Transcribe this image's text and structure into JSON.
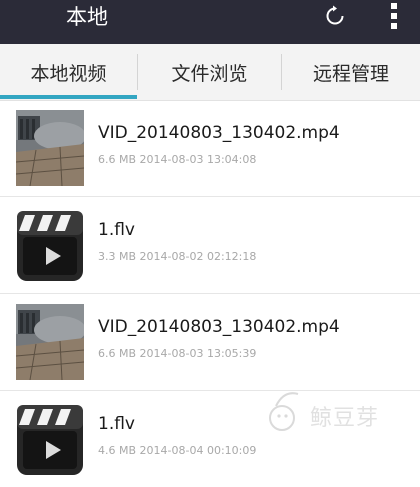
{
  "app": {
    "title": "本地",
    "icons": {
      "refresh": "refresh-icon",
      "more": "more-vert-icon"
    }
  },
  "tabs": [
    {
      "label": "本地视频",
      "active": true
    },
    {
      "label": "文件浏览",
      "active": false
    },
    {
      "label": "远程管理",
      "active": false
    }
  ],
  "colors": {
    "topbar": "#2b2b38",
    "tab_indicator": "#33a6c2",
    "meta_text": "#a8a8a8"
  },
  "files": [
    {
      "name": "VID_20140803_130402.mp4",
      "size": "6.6 MB",
      "date": "2014-08-03 13:04:08",
      "thumbnail": "video-frame-thumbnail"
    },
    {
      "name": "1.flv",
      "size": "3.3 MB",
      "date": "2014-08-02 02:12:18",
      "thumbnail": "clapperboard-icon"
    },
    {
      "name": "VID_20140803_130402.mp4",
      "size": "6.6 MB",
      "date": "2014-08-03 13:05:39",
      "thumbnail": "video-frame-thumbnail"
    },
    {
      "name": "1.flv",
      "size": "4.6 MB",
      "date": "2014-08-04 00:10:09",
      "thumbnail": "clapperboard-icon"
    }
  ],
  "watermark": {
    "text": "鲸豆芽"
  }
}
